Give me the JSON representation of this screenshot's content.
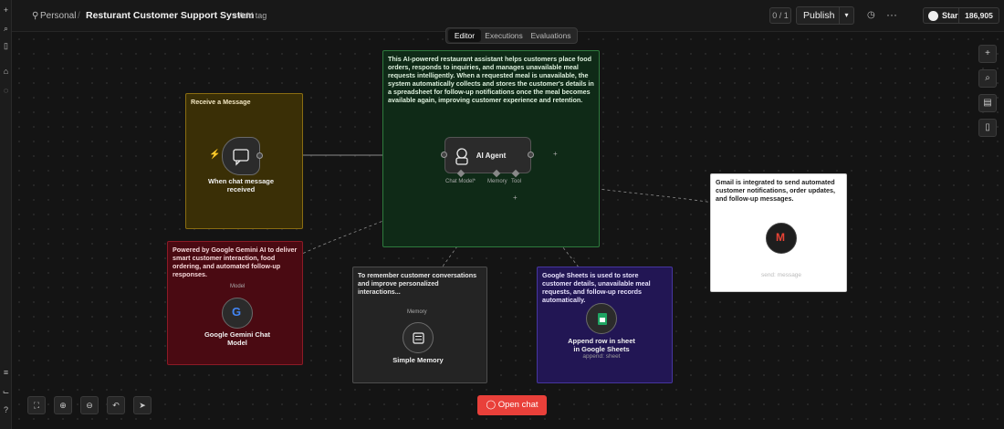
{
  "breadcrumb": {
    "workspace": "Personal",
    "title": "Resturant Customer Support System",
    "add_tag": "+ Add tag"
  },
  "header": {
    "counter": "0 / 1",
    "publish": "Publish",
    "star": "Star",
    "star_count": "186,905"
  },
  "tabs": [
    "Editor",
    "Executions",
    "Evaluations"
  ],
  "stickies": {
    "receive": "Receive a Message",
    "agent": "This AI-powered restaurant assistant helps customers place food orders, responds to inquiries, and manages unavailable meal requests intelligently. When a requested meal is unavailable, the system automatically collects and stores the customer's details in a spreadsheet for follow-up notifications once the meal becomes available again, improving customer experience and retention.",
    "gemini": "Powered by Google Gemini AI to deliver smart customer interaction, food ordering, and automated follow-up responses.",
    "memory": "To remember customer conversations and improve personalized interactions...",
    "sheets": "Google Sheets is used to store customer details, unavailable meal requests, and follow-up records automatically.",
    "gmail": "Gmail is integrated to send automated customer notifications, order updates, and follow-up messages."
  },
  "nodes": {
    "chat_trigger": "When chat message received",
    "agent": "AI Agent",
    "agent_ports": [
      "Chat Model*",
      "Memory",
      "Tool"
    ],
    "gemini": "Google Gemini Chat Model",
    "gemini_port": "Model",
    "memory": "Simple Memory",
    "memory_port": "Memory",
    "sheets": "Append row in sheet in Google Sheets",
    "sheets_sub": "append: sheet",
    "gmail_sub": "send: message"
  },
  "open_chat": "Open chat",
  "colors": {
    "accent": "#e9403a",
    "yellow": "#3a2f06",
    "green": "#0f2a17",
    "red": "#4a0a12",
    "purple": "#221654",
    "gray": "#242424"
  }
}
